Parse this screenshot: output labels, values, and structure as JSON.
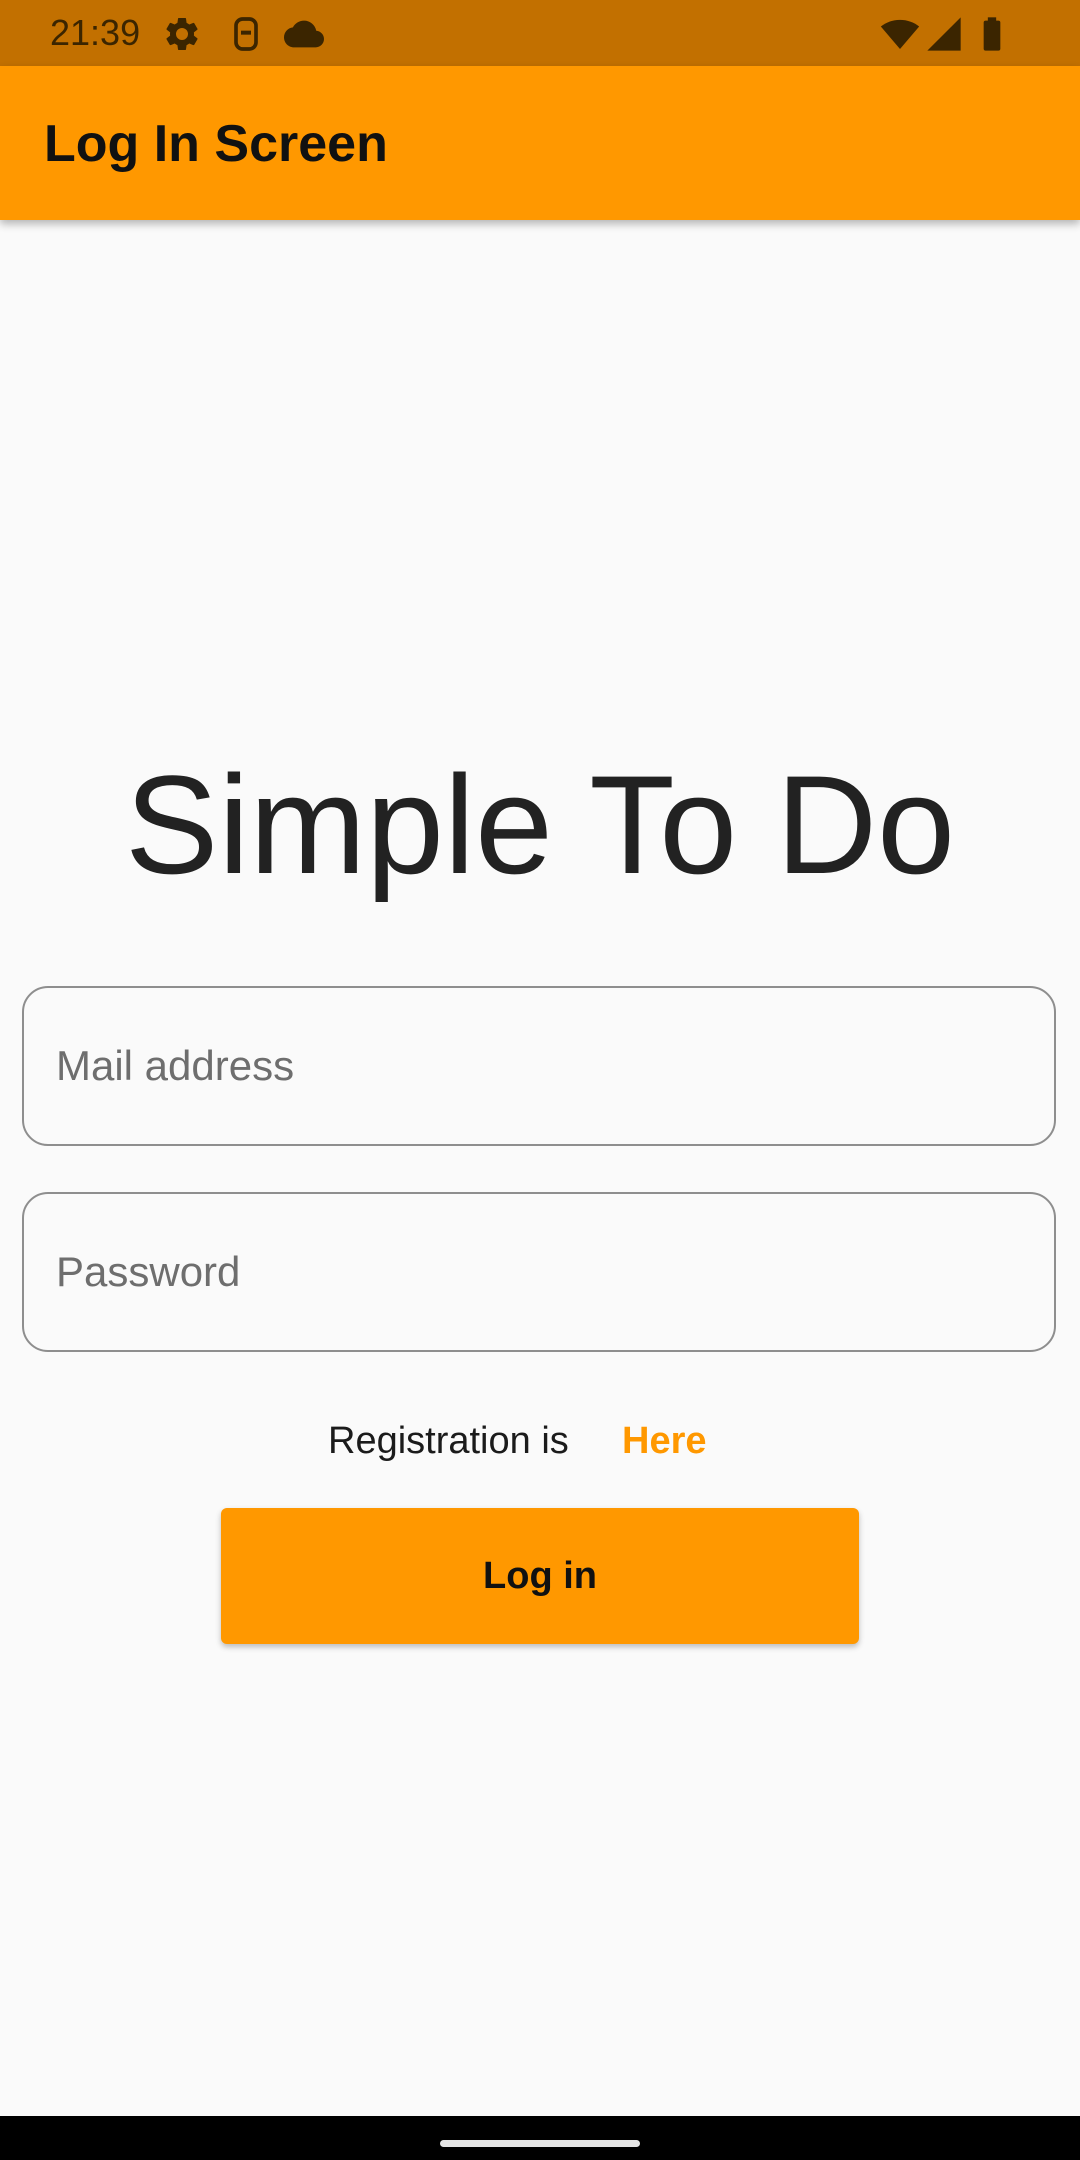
{
  "status_bar": {
    "time": "21:39",
    "icons_left": [
      "gear-icon",
      "sim-card-icon",
      "cloud-icon"
    ],
    "icons_right": [
      "wifi-icon",
      "cellular-signal-icon",
      "battery-icon"
    ]
  },
  "app_bar": {
    "title": "Log In Screen"
  },
  "main": {
    "headline": "Simple To Do",
    "email_field": {
      "placeholder": "Mail address",
      "value": ""
    },
    "password_field": {
      "placeholder": "Password",
      "value": ""
    },
    "registration": {
      "text": "Registration is",
      "link_label": "Here"
    },
    "login_button": {
      "label": "Log in"
    }
  },
  "colors": {
    "accent": "#ff9800",
    "status_bar": "#c27000",
    "background": "#fafafa"
  }
}
